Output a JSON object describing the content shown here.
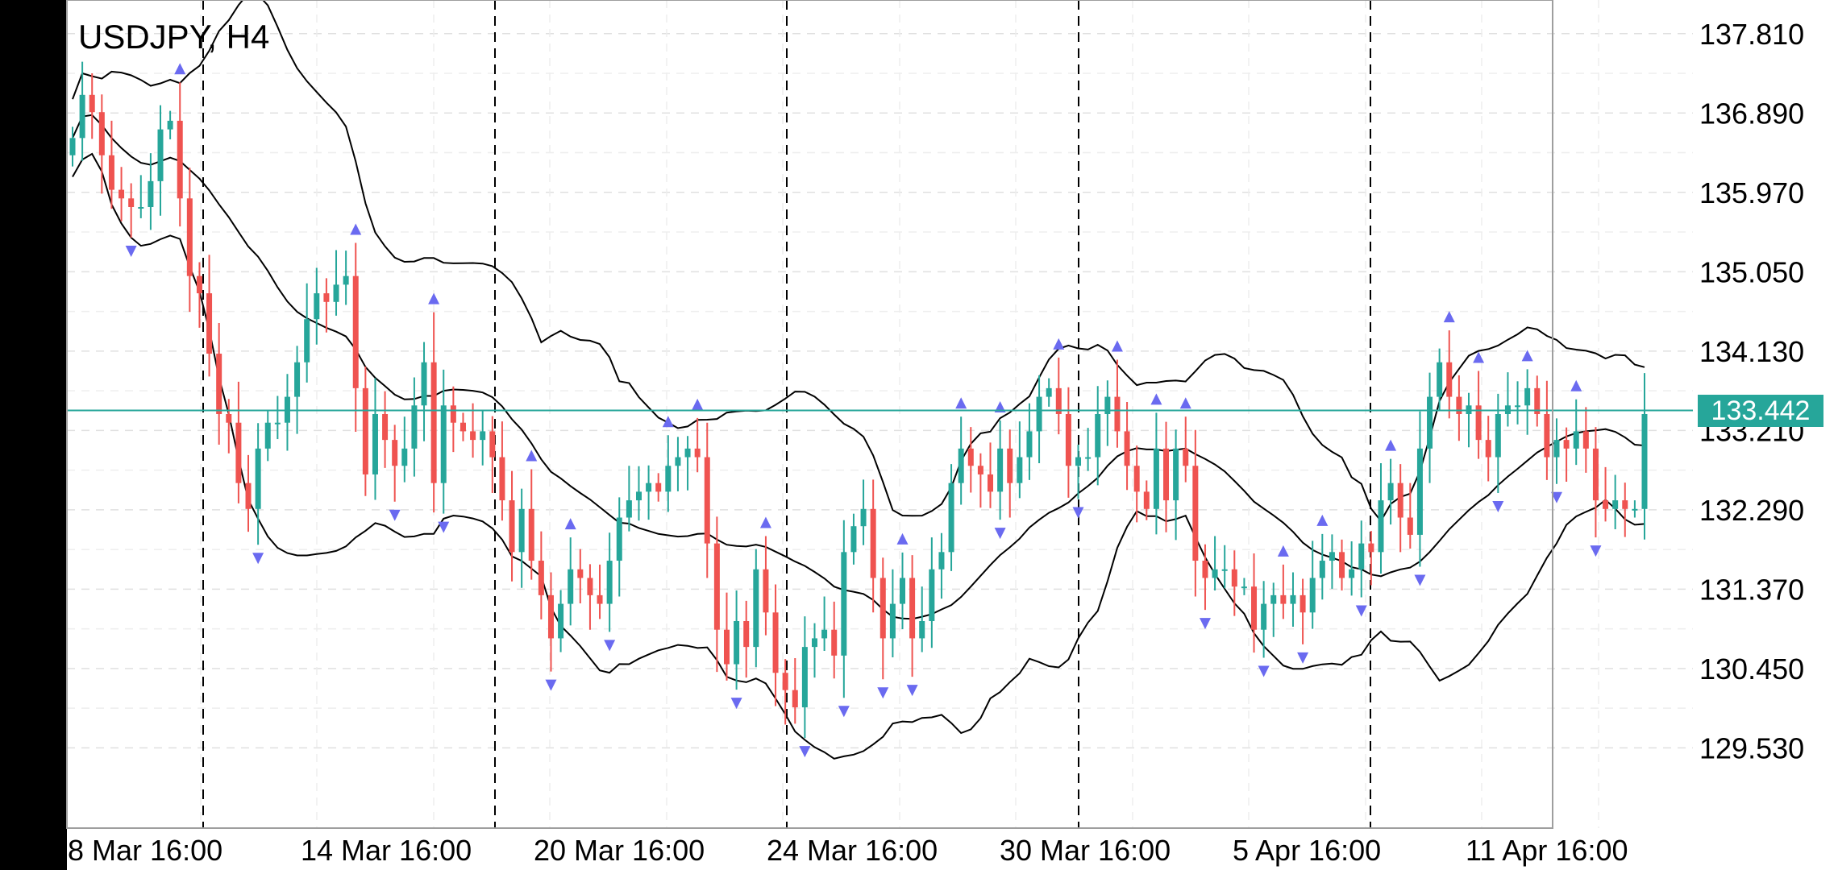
{
  "chart_data": {
    "type": "candlestick",
    "title": "USDJPY, H4",
    "symbol": "USDJPY",
    "timeframe": "H4",
    "current_price": "133.442",
    "ylim": [
      128.6,
      138.2
    ],
    "y_ticks": [
      "137.810",
      "136.890",
      "135.970",
      "135.050",
      "134.130",
      "133.210",
      "132.290",
      "131.370",
      "130.450",
      "129.530"
    ],
    "x_ticks": [
      "8 Mar 16:00",
      "14 Mar 16:00",
      "20 Mar 16:00",
      "24 Mar 16:00",
      "30 Mar 16:00",
      "5 Apr 16:00",
      "11 Apr 16:00"
    ],
    "day_separators": 5,
    "indicators": [
      "Bollinger Bands (upper, middle, lower)",
      "Fractals"
    ],
    "grid": true,
    "colors": {
      "up": "#26a69a",
      "down": "#ef5350",
      "bands": "#000000",
      "fractal": "#6a6af0",
      "price_line": "#26a69a"
    },
    "closes": [
      136.6,
      137.1,
      136.9,
      136.4,
      136.0,
      135.9,
      135.8,
      135.8,
      136.1,
      136.7,
      136.8,
      135.9,
      135.0,
      134.8,
      134.1,
      133.4,
      133.3,
      132.6,
      132.3,
      133.0,
      133.3,
      133.3,
      133.6,
      134.0,
      134.5,
      134.8,
      134.7,
      134.9,
      135.0,
      133.7,
      132.7,
      133.4,
      133.1,
      132.8,
      133.0,
      133.5,
      134.0,
      132.6,
      133.5,
      133.3,
      133.2,
      133.1,
      133.2,
      132.9,
      132.4,
      131.8,
      132.3,
      131.7,
      131.3,
      130.8,
      131.2,
      131.6,
      131.5,
      131.3,
      131.2,
      131.7,
      132.2,
      132.4,
      132.5,
      132.6,
      132.5,
      132.8,
      132.9,
      133.0,
      132.9,
      131.9,
      130.9,
      130.5,
      131.0,
      130.7,
      131.6,
      131.1,
      130.4,
      130.2,
      130.0,
      130.7,
      130.8,
      130.9,
      130.6,
      131.8,
      132.1,
      132.3,
      131.5,
      130.8,
      131.2,
      131.5,
      130.8,
      131.0,
      131.6,
      131.8,
      132.6,
      133.0,
      132.8,
      132.7,
      132.5,
      133.0,
      132.6,
      132.9,
      133.2,
      133.6,
      133.7,
      133.4,
      132.8,
      132.9,
      132.9,
      133.4,
      133.6,
      133.2,
      132.8,
      132.5,
      132.3,
      133.0,
      132.4,
      133.0,
      132.8,
      131.7,
      131.5,
      131.6,
      131.6,
      131.4,
      131.4,
      130.9,
      131.2,
      131.3,
      131.2,
      131.3,
      131.1,
      131.5,
      131.7,
      131.8,
      131.5,
      131.6,
      131.9,
      131.8,
      132.4,
      132.6,
      132.2,
      132.0,
      133.0,
      133.6,
      134.0,
      133.6,
      133.4,
      133.5,
      133.1,
      132.9,
      133.4,
      133.5,
      133.5,
      133.7,
      133.4,
      132.9,
      133.1,
      133.0,
      133.2,
      133.0,
      132.4,
      132.3,
      132.4,
      132.3,
      132.3,
      133.4
    ]
  }
}
